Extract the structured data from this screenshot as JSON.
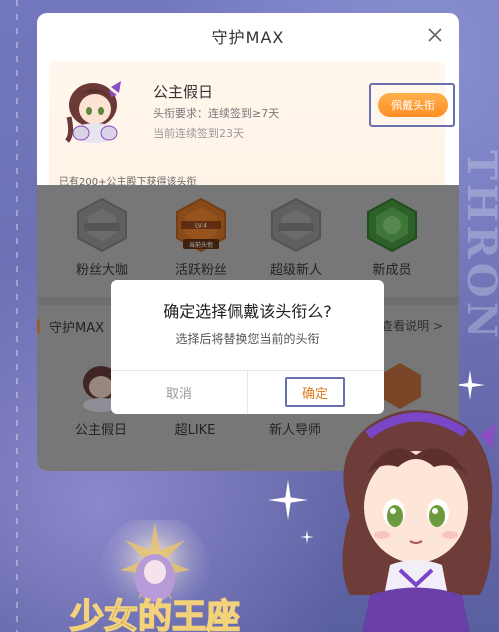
{
  "modal": {
    "title": "守护MAX",
    "close_icon": "close-icon"
  },
  "selected_title": {
    "name": "公主假日",
    "requirement": "头衔要求：连续签到≥7天",
    "current": "当前连续签到23天",
    "wear_button": "佩戴头衔",
    "owners": "已有200+公主殿下获得该头衔"
  },
  "badges": [
    {
      "label": "粉丝大咖",
      "icon": "gray-hexagon-badge-icon",
      "color": "#8a8a8a"
    },
    {
      "label": "活跃粉丝",
      "icon": "orange-hexagon-badge-icon",
      "color": "#d9772c",
      "tag": "当前头衔"
    },
    {
      "label": "超级新人",
      "icon": "gray-hexagon-badge-icon",
      "color": "#8a8a8a"
    },
    {
      "label": "新成员",
      "icon": "green-hexagon-badge-icon",
      "color": "#4f9a4a"
    }
  ],
  "section": {
    "title": "守护MAX",
    "link": "查看说明 >"
  },
  "titles": [
    {
      "label": "公主假日",
      "icon": "princess-avatar-icon"
    },
    {
      "label": "超LIKE",
      "icon": "like-icon"
    },
    {
      "label": "新人导师",
      "icon": "mentor-icon"
    }
  ],
  "dialog": {
    "title": "确定选择佩戴该头衔么?",
    "message": "选择后将替换您当前的头衔",
    "cancel": "取消",
    "confirm": "确定"
  },
  "background": {
    "vertical_text": "THRON",
    "logo_text": "少女的王座"
  },
  "colors": {
    "accent": "#ff9a2e",
    "highlight_frame": "#6870b0",
    "background": "#6f74b8",
    "dim_overlay": "#ababab"
  }
}
